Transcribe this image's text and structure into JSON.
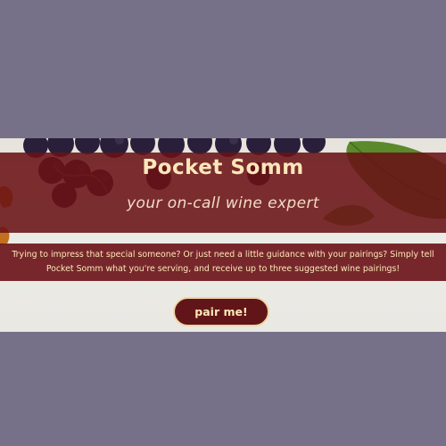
{
  "hero": {
    "title": "Pocket Somm",
    "subtitle": "your on-call wine expert",
    "description": "Trying to impress that special someone? Or just need a little guidance with your pairings? Simply tell Pocket Somm what you're serving, and receive up to three suggested wine pairings!",
    "button_label": "pair me!"
  },
  "colors": {
    "page_background": "#767088",
    "banner": "#6a1216",
    "text_accent": "#fbe7b9",
    "button": "#621518"
  }
}
